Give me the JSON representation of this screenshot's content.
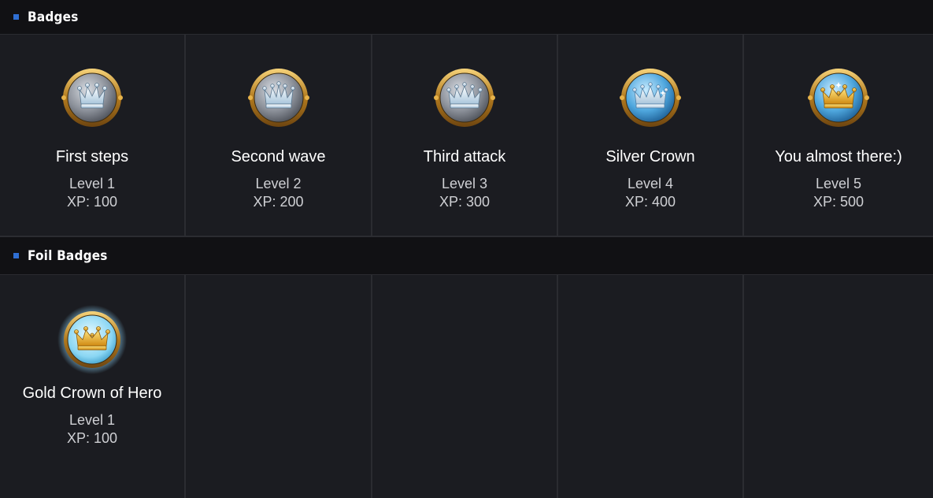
{
  "sections": {
    "badges": {
      "title": "Badges",
      "items": [
        {
          "name": "First steps",
          "level": "Level 1",
          "xp": "XP: 100",
          "icon": "silver-crown-grey-icon"
        },
        {
          "name": "Second wave",
          "level": "Level 2",
          "xp": "XP: 200",
          "icon": "silver-crown-grey-icon"
        },
        {
          "name": "Third attack",
          "level": "Level 3",
          "xp": "XP: 300",
          "icon": "silver-crown-grey-icon"
        },
        {
          "name": "Silver Crown",
          "level": "Level 4",
          "xp": "XP: 400",
          "icon": "silver-crown-blue-icon"
        },
        {
          "name": "You almost there:)",
          "level": "Level 5",
          "xp": "XP: 500",
          "icon": "gold-crown-blue-icon"
        }
      ]
    },
    "foil": {
      "title": "Foil Badges",
      "items": [
        {
          "name": "Gold Crown of Hero",
          "level": "Level 1",
          "xp": "XP: 100",
          "icon": "gold-crown-glow-icon"
        }
      ]
    }
  },
  "colors": {
    "accent": "#2f6fd3",
    "background": "#1b1c21",
    "header_background": "#111114",
    "gold": "#e0a62a"
  }
}
